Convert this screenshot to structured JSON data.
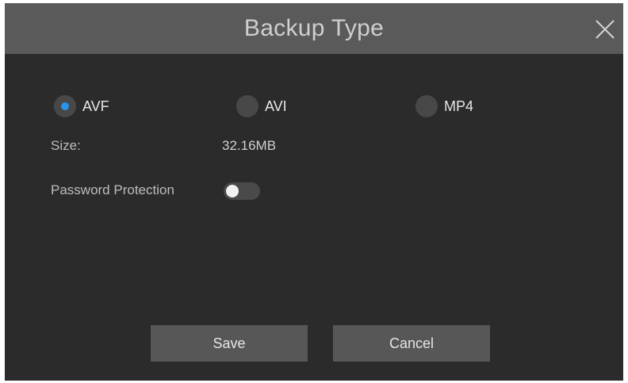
{
  "dialog": {
    "title": "Backup Type",
    "close_icon": "close-icon"
  },
  "backup_type": {
    "options": [
      {
        "label": "AVF",
        "selected": true
      },
      {
        "label": "AVI",
        "selected": false
      },
      {
        "label": "MP4",
        "selected": false
      }
    ],
    "accent_color": "#2b93e6"
  },
  "size": {
    "label": "Size:",
    "value": "32.16MB"
  },
  "password_protection": {
    "label": "Password Protection",
    "enabled": false
  },
  "buttons": {
    "save": "Save",
    "cancel": "Cancel"
  }
}
